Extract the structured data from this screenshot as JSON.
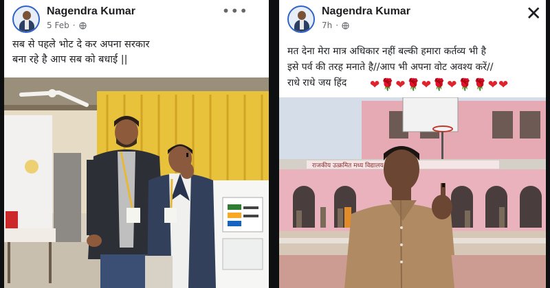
{
  "post_left": {
    "author": "Nagendra Kumar",
    "date": "5 Feb",
    "more_icon": "more-horizontal-icon",
    "caption_line1": "सब से पहले भोट दे कर अपना सरकार",
    "caption_line2": "बना रहे है आप सब को बधाई ||"
  },
  "post_right": {
    "author": "Nagendra Kumar",
    "date": "7h",
    "close_icon": "close-icon",
    "caption_line1": "मत देना मेरा मात्र अधिकार नहीं बल्की हमारा कर्तव्य भी है",
    "caption_line2": "इसे पर्व की तरह मनाते है//आप भी अपना वोट अवश्य करें//",
    "caption_line3": "राधे राधे जय हिंद",
    "emojis": "❤🌹❤🌹❤🌹❤🌹🌹❤❤",
    "school_sign": "राजकीय उत्क्रमित मध्य विद्यालय ... ग्राम..."
  },
  "colors": {
    "page_bg": "#0e0f10",
    "card_bg": "#ffffff",
    "text": "#1c1e21",
    "meta": "#65676b",
    "heart": "#e0242d",
    "school_pink": "#e7a9b4"
  }
}
